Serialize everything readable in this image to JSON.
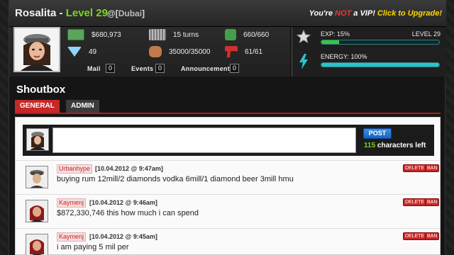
{
  "header": {
    "player_name": "Rosalita",
    "separator": " - ",
    "level_text": "Level 29",
    "city_prefix": "@[",
    "city": "Dubai",
    "city_suffix": "]",
    "vip_pre": "You're ",
    "vip_not": "NOT",
    "vip_mid": " a VIP! ",
    "vip_link": "Click to Upgrade!"
  },
  "stats": {
    "cash": "$680,973",
    "turns": "15 turns",
    "health": "660/660",
    "diamonds": "49",
    "strength": "35000/35000",
    "weapons": "61/61"
  },
  "counters": {
    "mail_label": "Mail",
    "mail_count": "0",
    "events_label": "Events",
    "events_count": "0",
    "announcements_label": "Announcements",
    "announcements_count": "0"
  },
  "progress": {
    "exp_label": "EXP: 15%",
    "exp_percent": 15,
    "level_label": "LEVEL 29",
    "energy_label": "ENERGY: 100%",
    "energy_percent": 100
  },
  "shoutbox": {
    "title": "Shoutbox",
    "tabs": [
      "GENERAL",
      "ADMIN"
    ],
    "post_label": "POST",
    "chars_left_num": "115",
    "chars_left_text": " characters left",
    "delete_label": "DELETE",
    "ban_label": "BAN",
    "messages": [
      {
        "user": "Urbanhype",
        "time": "[10.04.2012 @ 9:47am]",
        "text": "buying rum 12mill/2 diamonds vodka 6mill/1 diamond beer 3mill hmu"
      },
      {
        "user": "Kaymenj",
        "time": "[10.04.2012 @ 9:46am]",
        "text": "$872,330,746 this how much i can spend"
      },
      {
        "user": "Kaymenj",
        "time": "[10.04.2012 @ 9:45am]",
        "text": "i am paying 5 mil per"
      }
    ]
  },
  "colors": {
    "accent_red": "#c62828",
    "level_green": "#7ed321",
    "vip_yellow": "#ffd600",
    "bar_cyan": "#29c4cf",
    "bar_green": "#2ecc40"
  }
}
